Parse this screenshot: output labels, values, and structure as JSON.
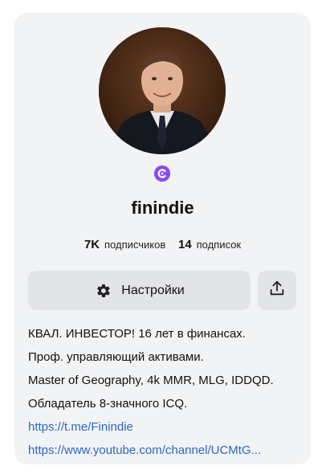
{
  "profile": {
    "name": "finindie",
    "badge_color": "#8b49f5",
    "avatar_icon": "avatar-photo"
  },
  "stats": {
    "subscribers_count": "7K",
    "subscribers_label": "подписчиков",
    "subscriptions_count": "14",
    "subscriptions_label": "подписок"
  },
  "actions": {
    "settings_label": "Настройки",
    "settings_icon": "gear-icon",
    "share_icon": "share-icon"
  },
  "bio": {
    "lines": [
      "КВАЛ. ИНВЕСТОР! 16 лет в финансах.",
      "Проф. управляющий активами.",
      "Master of Geography, 4k MMR, MLG, IDDQD.",
      "Обладатель 8-значного ICQ."
    ],
    "links": [
      "https://t.me/Finindie",
      "https://www.youtube.com/channel/UCMtG..."
    ],
    "link_color": "#2b66c9"
  }
}
